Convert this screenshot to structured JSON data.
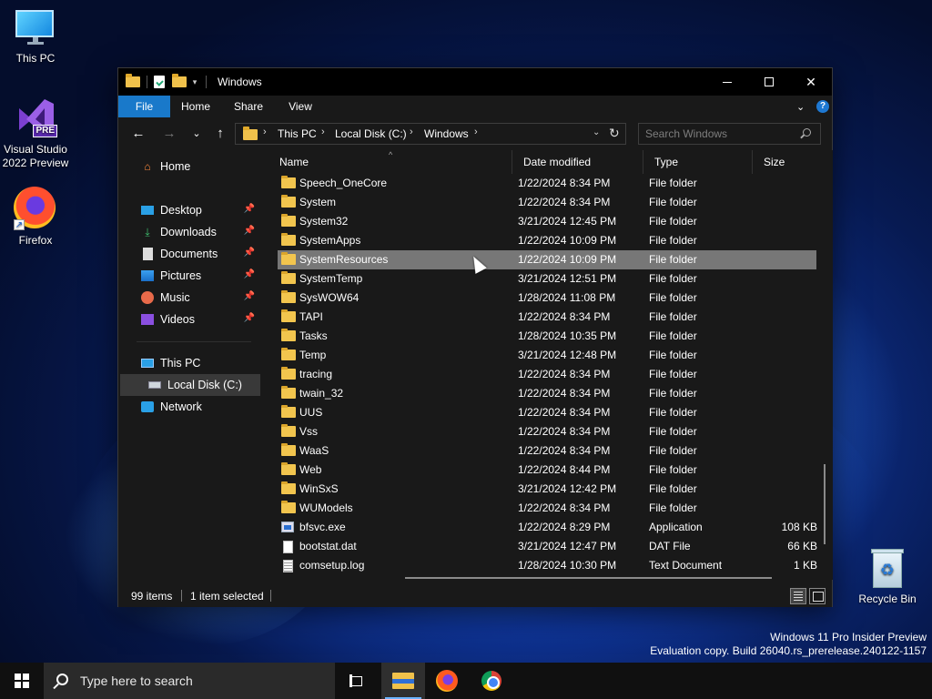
{
  "desktop": {
    "icons": [
      {
        "label": "This PC"
      },
      {
        "label": "Visual Studio 2022 Preview",
        "badge": "PRE"
      },
      {
        "label": "Firefox"
      },
      {
        "label": "Recycle Bin"
      }
    ],
    "watermark": {
      "line1": "Windows 11 Pro Insider Preview",
      "line2": "Evaluation copy. Build 26040.rs_prerelease.240122-1157"
    }
  },
  "window": {
    "title": "Windows",
    "ribbon": {
      "tabs": [
        "File",
        "Home",
        "Share",
        "View"
      ]
    },
    "breadcrumb": [
      "This PC",
      "Local Disk (C:)",
      "Windows"
    ],
    "search": {
      "placeholder": "Search Windows"
    },
    "nav": {
      "home": "Home",
      "quick_access": [
        {
          "label": "Desktop",
          "icon": "desktop-icon"
        },
        {
          "label": "Downloads",
          "icon": "download-icon"
        },
        {
          "label": "Documents",
          "icon": "documents-icon"
        },
        {
          "label": "Pictures",
          "icon": "pictures-icon"
        },
        {
          "label": "Music",
          "icon": "music-icon"
        },
        {
          "label": "Videos",
          "icon": "videos-icon"
        }
      ],
      "this_pc": "This PC",
      "local_disk": "Local Disk (C:)",
      "network": "Network"
    },
    "columns": {
      "name": "Name",
      "date": "Date modified",
      "type": "Type",
      "size": "Size"
    },
    "files": [
      {
        "name": "Speech_OneCore",
        "date": "1/22/2024 8:34 PM",
        "type": "File folder",
        "size": "",
        "kind": "folder"
      },
      {
        "name": "System",
        "date": "1/22/2024 8:34 PM",
        "type": "File folder",
        "size": "",
        "kind": "folder"
      },
      {
        "name": "System32",
        "date": "3/21/2024 12:45 PM",
        "type": "File folder",
        "size": "",
        "kind": "folder"
      },
      {
        "name": "SystemApps",
        "date": "1/22/2024 10:09 PM",
        "type": "File folder",
        "size": "",
        "kind": "folder"
      },
      {
        "name": "SystemResources",
        "date": "1/22/2024 10:09 PM",
        "type": "File folder",
        "size": "",
        "kind": "folder",
        "selected": true
      },
      {
        "name": "SystemTemp",
        "date": "3/21/2024 12:51 PM",
        "type": "File folder",
        "size": "",
        "kind": "folder"
      },
      {
        "name": "SysWOW64",
        "date": "1/28/2024 11:08 PM",
        "type": "File folder",
        "size": "",
        "kind": "folder"
      },
      {
        "name": "TAPI",
        "date": "1/22/2024 8:34 PM",
        "type": "File folder",
        "size": "",
        "kind": "folder"
      },
      {
        "name": "Tasks",
        "date": "1/28/2024 10:35 PM",
        "type": "File folder",
        "size": "",
        "kind": "folder"
      },
      {
        "name": "Temp",
        "date": "3/21/2024 12:48 PM",
        "type": "File folder",
        "size": "",
        "kind": "folder"
      },
      {
        "name": "tracing",
        "date": "1/22/2024 8:34 PM",
        "type": "File folder",
        "size": "",
        "kind": "folder"
      },
      {
        "name": "twain_32",
        "date": "1/22/2024 8:34 PM",
        "type": "File folder",
        "size": "",
        "kind": "folder"
      },
      {
        "name": "UUS",
        "date": "1/22/2024 8:34 PM",
        "type": "File folder",
        "size": "",
        "kind": "folder"
      },
      {
        "name": "Vss",
        "date": "1/22/2024 8:34 PM",
        "type": "File folder",
        "size": "",
        "kind": "folder"
      },
      {
        "name": "WaaS",
        "date": "1/22/2024 8:34 PM",
        "type": "File folder",
        "size": "",
        "kind": "folder"
      },
      {
        "name": "Web",
        "date": "1/22/2024 8:44 PM",
        "type": "File folder",
        "size": "",
        "kind": "folder"
      },
      {
        "name": "WinSxS",
        "date": "3/21/2024 12:42 PM",
        "type": "File folder",
        "size": "",
        "kind": "folder"
      },
      {
        "name": "WUModels",
        "date": "1/22/2024 8:34 PM",
        "type": "File folder",
        "size": "",
        "kind": "folder"
      },
      {
        "name": "bfsvc.exe",
        "date": "1/22/2024 8:29 PM",
        "type": "Application",
        "size": "108 KB",
        "kind": "exe"
      },
      {
        "name": "bootstat.dat",
        "date": "3/21/2024 12:47 PM",
        "type": "DAT File",
        "size": "66 KB",
        "kind": "dat"
      },
      {
        "name": "comsetup.log",
        "date": "1/28/2024 10:30 PM",
        "type": "Text Document",
        "size": "1 KB",
        "kind": "log"
      }
    ],
    "status": {
      "items": "99 items",
      "selected": "1 item selected"
    }
  },
  "taskbar": {
    "search_placeholder": "Type here to search",
    "apps": [
      "task-view",
      "file-explorer",
      "firefox",
      "chrome"
    ]
  },
  "colors": {
    "accent": "#1979ca",
    "selection": "#777777",
    "window_bg": "#191919"
  }
}
